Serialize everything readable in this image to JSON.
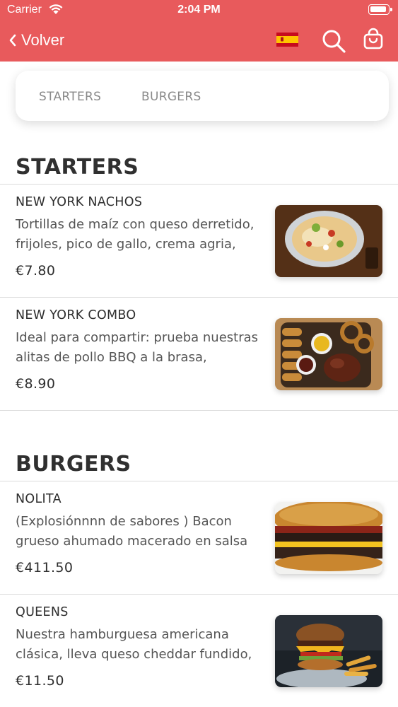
{
  "status_bar": {
    "carrier": "Carrier",
    "time": "2:04 PM"
  },
  "nav": {
    "back_label": "Volver",
    "flag": "spain-flag-icon"
  },
  "tabs": [
    {
      "label": "STARTERS"
    },
    {
      "label": "BURGERS"
    }
  ],
  "sections": [
    {
      "title": "STARTERS",
      "items": [
        {
          "name": "NEW YORK NACHOS",
          "description": "Tortillas de maíz con queso derretido, frijoles, pico de gallo, crema agria,",
          "price": "€7.80",
          "image": "nachos-image"
        },
        {
          "name": "NEW YORK COMBO",
          "description": "Ideal para compartir: prueba nuestras alitas de pollo BBQ a la brasa,",
          "price": "€8.90",
          "image": "combo-platter-image"
        }
      ]
    },
    {
      "title": "BURGERS",
      "items": [
        {
          "name": "NOLITA",
          "description": "(Explosiónnnn de sabores ) Bacon grueso ahumado macerado en salsa",
          "price": "€411.50",
          "image": "nolita-burger-image"
        },
        {
          "name": "QUEENS",
          "description": "Nuestra hamburguesa americana clásica, lleva queso cheddar fundido,",
          "price": "€11.50",
          "image": "queens-burger-image"
        }
      ]
    }
  ],
  "colors": {
    "header": "#e85a5c",
    "text": "#2e2e2e",
    "muted": "#555555",
    "tab_text": "#8a8a8a"
  }
}
